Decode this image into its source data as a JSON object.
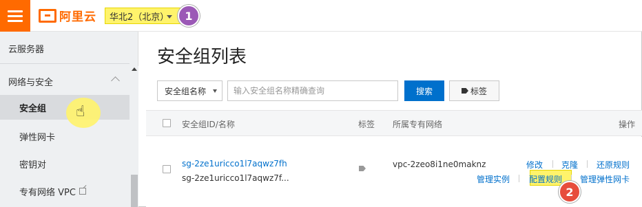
{
  "topbar": {
    "brand": "阿里云",
    "region": "华北2（北京）",
    "step1": "1"
  },
  "sidebar": {
    "top_item": "云服务器",
    "section": "网络与安全",
    "items": [
      {
        "label": "安全组",
        "active": true
      },
      {
        "label": "弹性网卡",
        "active": false
      },
      {
        "label": "密钥对",
        "active": false
      },
      {
        "label": "专有网络 VPC",
        "active": false
      }
    ]
  },
  "main": {
    "title": "安全组列表",
    "filter_select": "安全组名称",
    "search_placeholder": "输入安全组名称精确查询",
    "search_button": "搜索",
    "tag_button": "标签",
    "columns": {
      "id_name": "安全组ID/名称",
      "tags": "标签",
      "vpc": "所属专有网络",
      "actions": "操作"
    },
    "rows": [
      {
        "id": "sg-2ze1uricco1l7aqwz7fh",
        "name": "sg-2ze1uricco1l7aqwz7f...",
        "vpc": "vpc-2zeo8i1ne0maknz",
        "actions_row1": [
          "修改",
          "克隆",
          "还原规则"
        ],
        "actions_row2": [
          "管理实例",
          "配置规则",
          "管理弹性网卡"
        ]
      }
    ],
    "step2": "2"
  },
  "colors": {
    "brand_orange": "#ff6a00",
    "highlight_yellow": "#fff36b",
    "step_badge_purple": "#9b59b6",
    "step_badge_red": "#e74c3c",
    "link_blue": "#0070cc"
  }
}
